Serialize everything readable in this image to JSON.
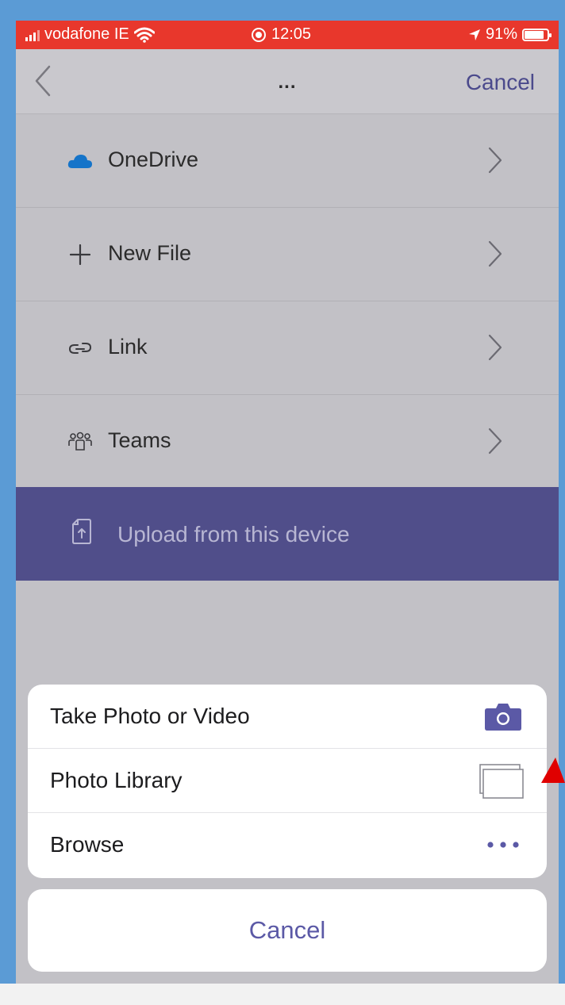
{
  "status_bar": {
    "carrier": "vodafone IE",
    "time": "12:05",
    "battery": "91%",
    "battery_level": 0.91,
    "background_color": "#e8372c"
  },
  "nav": {
    "title": "...",
    "cancel_label": "Cancel",
    "back_icon": "chevron-left-icon"
  },
  "menu": {
    "items": [
      {
        "label": "OneDrive",
        "icon": "onedrive-cloud-icon"
      },
      {
        "label": "New File",
        "icon": "plus-icon"
      },
      {
        "label": "Link",
        "icon": "link-icon"
      },
      {
        "label": "Teams",
        "icon": "teams-icon"
      }
    ],
    "upload": {
      "label": "Upload from this device",
      "icon": "upload-file-icon"
    }
  },
  "action_sheet": {
    "items": [
      {
        "label": "Take Photo or Video",
        "icon": "camera-icon"
      },
      {
        "label": "Photo Library",
        "icon": "photo-library-icon"
      },
      {
        "label": "Browse",
        "icon": "more-dots-icon"
      }
    ],
    "cancel_label": "Cancel"
  },
  "colors": {
    "accent": "#504e8a",
    "link_text": "#4b4a8c",
    "annotation_arrow": "#e00000"
  }
}
